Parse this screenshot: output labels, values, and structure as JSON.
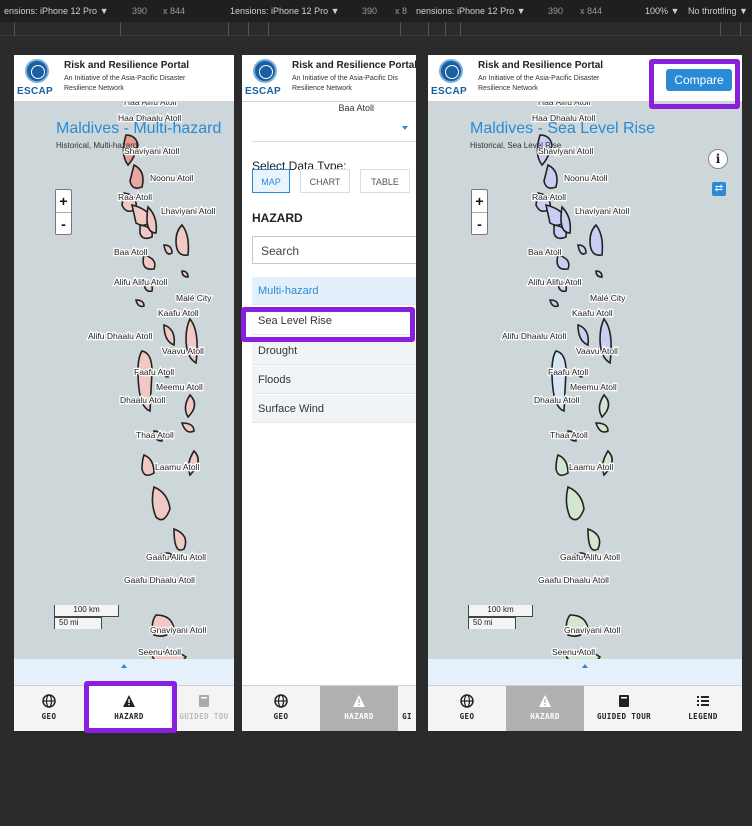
{
  "devtools": {
    "dim1": "ensions: iPhone 12 Pro ▼",
    "w1": "390",
    "h1": "x  844",
    "dim2": "1ensions: iPhone 12 Pro ▼",
    "w2": "390",
    "h2": "x  8",
    "dim3": "nensions: iPhone 12 Pro ▼",
    "w3": "390",
    "h3": "x  844",
    "zoom": "100% ▼",
    "throttle": "No throttling ▼"
  },
  "brand": {
    "logo_text": "ESCAP",
    "title": "Risk and Resilience Portal",
    "subtitle_line1": "An Initiative of the Asia-Pacific Disaster",
    "subtitle_line2": "Resilience Network",
    "subtitle_mid_line1": "An Initiative of the Asia-Pacific Dis",
    "subtitle_mid_line2": "Resilience Network",
    "title_mid": "Risk and Resilience Portal"
  },
  "left_panel": {
    "map_title": "Maldives - Multi-hazard",
    "map_subtitle": "Historical, Multi-hazard",
    "zoom_in": "+",
    "zoom_out": "-",
    "scale_km": "100 km",
    "scale_mi": "50 mi"
  },
  "right_panel": {
    "map_title": "Maldives - Sea Level Rise",
    "map_subtitle": "Historical, Sea Level Rise",
    "compare_label": "Compare",
    "info_label": "i",
    "swap_label": "⇄",
    "zoom_in": "+",
    "zoom_out": "-",
    "scale_km": "100 km",
    "scale_mi": "50 mi"
  },
  "map_labels": [
    "Haa Alifu Atoll",
    "Haa Dhaalu Atoll",
    "Shaviyani Atoll",
    "Noonu Atoll",
    "Raa Atoll",
    "Lhaviyani Atoll",
    "Baa Atoll",
    "Alifu Alifu Atoll",
    "Malé City",
    "Kaafu Atoll",
    "Alifu Dhaalu Atoll",
    "Vaavu Atoll",
    "Faafu Atoll",
    "Meemu Atoll",
    "Dhaalu Atoll",
    "Thaa Atoll",
    "Laamu Atoll",
    "Gaafu Alifu Atoll",
    "Gaafu Dhaalu Atoll",
    "Gnaviyani Atoll",
    "Seenu Atoll"
  ],
  "middle_panel": {
    "location_value": "Baa Atoll",
    "select_data_type": "Select Data Type:",
    "data_types": [
      "MAP",
      "CHART",
      "TABLE"
    ],
    "hazard_heading": "HAZARD",
    "search_placeholder": "Search",
    "hazards": [
      "Multi-hazard",
      "Sea Level Rise",
      "Drought",
      "Floods",
      "Surface Wind"
    ]
  },
  "nav": {
    "geo": "GEO",
    "hazard": "HAZARD",
    "guided_tour": "GUIDED TOUR",
    "guided_tour_cut": "GUIDED TOU",
    "guided_tour_cut2": "GI",
    "legend": "LEGEND"
  },
  "colors": {
    "accent": "#2a8ad6",
    "highlight": "#8a1fe0",
    "multi_hazard_fill": "#f0c8c4",
    "slr_fill_blue": "#c9cef2",
    "slr_fill_green": "#d3e6cf"
  }
}
